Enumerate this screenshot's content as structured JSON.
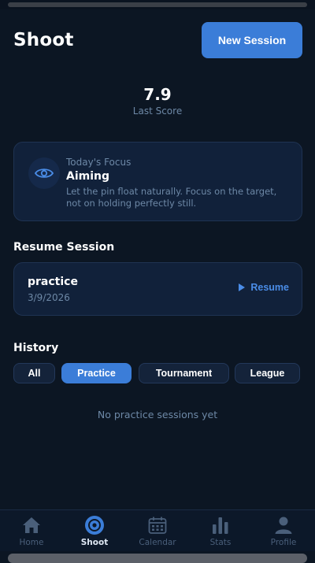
{
  "header": {
    "title": "Shoot",
    "new_session_label": "New Session"
  },
  "score": {
    "value": "7.9",
    "label": "Last Score"
  },
  "focus": {
    "kicker": "Today's Focus",
    "title": "Aiming",
    "description": "Let the pin float naturally. Focus on the target, not on holding perfectly still.",
    "icon": "eye-icon"
  },
  "resume": {
    "section_title": "Resume Session",
    "session_name": "practice",
    "session_date": "3/9/2026",
    "action_label": "Resume"
  },
  "history": {
    "section_title": "History",
    "filters": [
      {
        "label": "All",
        "active": false
      },
      {
        "label": "Practice",
        "active": true
      },
      {
        "label": "Tournament",
        "active": false
      },
      {
        "label": "League",
        "active": false
      }
    ],
    "empty_message": "No practice sessions yet"
  },
  "tabbar": {
    "items": [
      {
        "label": "Home",
        "icon": "home-icon",
        "active": false
      },
      {
        "label": "Shoot",
        "icon": "target-icon",
        "active": true
      },
      {
        "label": "Calendar",
        "icon": "calendar-icon",
        "active": false
      },
      {
        "label": "Stats",
        "icon": "bar-chart-icon",
        "active": false
      },
      {
        "label": "Profile",
        "icon": "person-icon",
        "active": false
      }
    ]
  },
  "colors": {
    "accent": "#3b7dd8",
    "background": "#0c1623",
    "card": "#11213a",
    "muted": "#6d88a6",
    "link": "#4a8ce6"
  }
}
